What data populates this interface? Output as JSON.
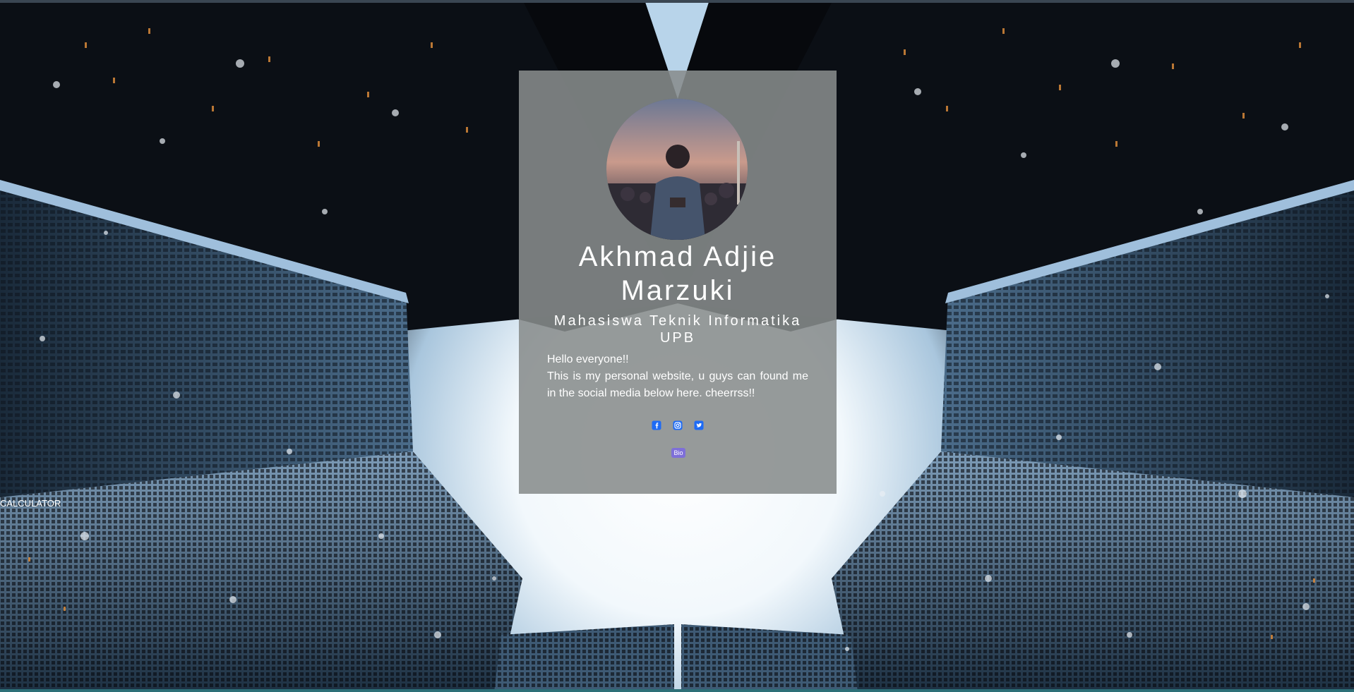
{
  "profile": {
    "avatar_icon": "profile-photo",
    "name": "Akhmad Adjie Marzuki",
    "subtitle": "Mahasiswa Teknik Informatika UPB",
    "bio_line1": "Hello everyone!!",
    "bio_line2": "This is my personal website, u guys can found me in the social media below here. cheerrss!!"
  },
  "socials": [
    {
      "icon": "facebook-icon"
    },
    {
      "icon": "instagram-icon"
    },
    {
      "icon": "twitter-icon"
    }
  ],
  "actions": {
    "bio_button": "Bio",
    "calculator_link": "CALCULATOR"
  },
  "colors": {
    "card_bg": "#878c8c",
    "social_icon": "#1e6bf5",
    "bio_button": "#7e6fd8",
    "text": "#ffffff"
  }
}
